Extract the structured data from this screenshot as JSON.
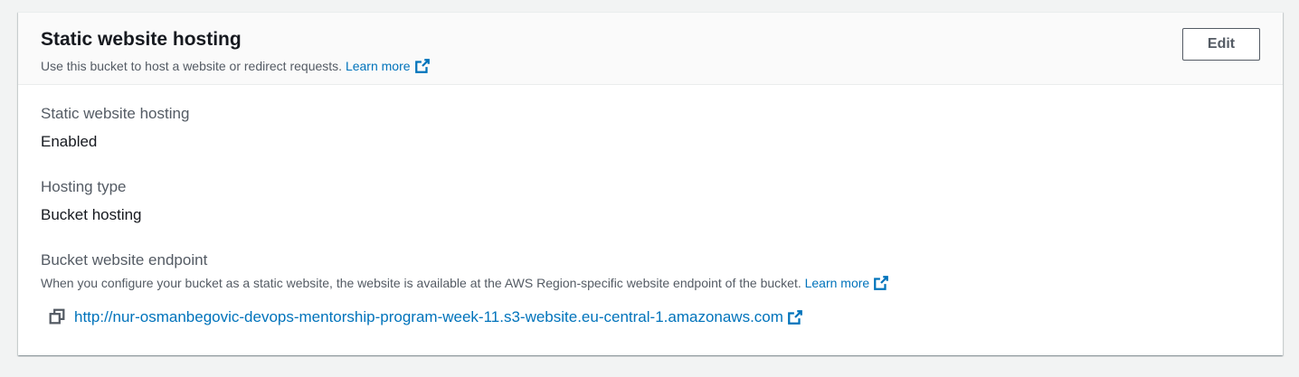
{
  "section": {
    "title": "Static website hosting",
    "description": "Use this bucket to host a website or redirect requests.",
    "learn_more": "Learn more",
    "edit_label": "Edit"
  },
  "fields": {
    "hosting": {
      "label": "Static website hosting",
      "value": "Enabled"
    },
    "hosting_type": {
      "label": "Hosting type",
      "value": "Bucket hosting"
    },
    "endpoint": {
      "label": "Bucket website endpoint",
      "description": "When you configure your bucket as a static website, the website is available at the AWS Region-specific website endpoint of the bucket.",
      "learn_more": "Learn more",
      "url": "http://nur-osmanbegovic-devops-mentorship-program-week-11.s3-website.eu-central-1.amazonaws.com"
    }
  },
  "icons": {
    "external_link": "external-link-icon",
    "copy": "copy-icon"
  },
  "colors": {
    "link": "#0073bb",
    "text": "#16191f",
    "secondary_text": "#545b64",
    "background": "#f2f3f3"
  }
}
